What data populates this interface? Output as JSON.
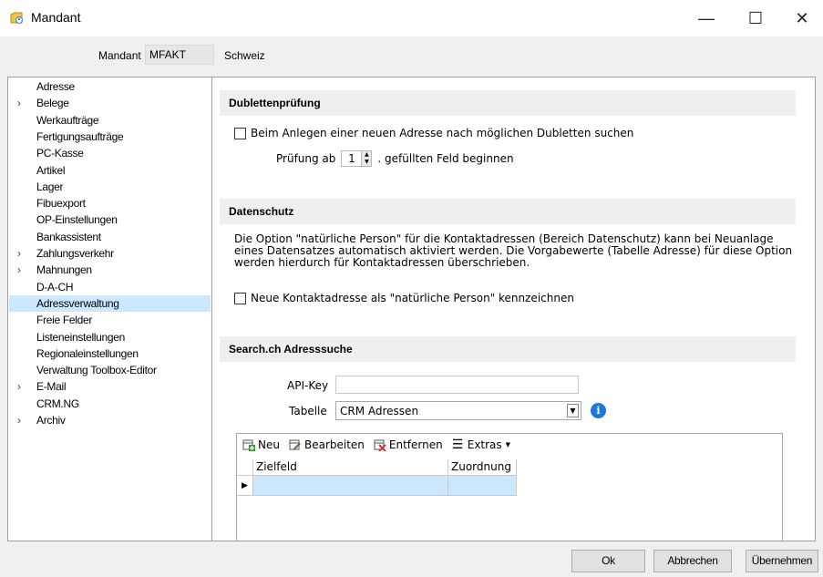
{
  "window": {
    "title": "Mandant",
    "minimize": "—",
    "maximize": "☐",
    "close": "✕"
  },
  "header": {
    "mandant_label": "Mandant",
    "mandant_code": "MFAKT",
    "mandant_name": "Schweiz"
  },
  "sidebar": {
    "items": [
      {
        "label": "Adresse",
        "expandable": false
      },
      {
        "label": "Belege",
        "expandable": true
      },
      {
        "label": "Werkaufträge",
        "expandable": false
      },
      {
        "label": "Fertigungsaufträge",
        "expandable": false
      },
      {
        "label": "PC-Kasse",
        "expandable": false
      },
      {
        "label": "Artikel",
        "expandable": false
      },
      {
        "label": "Lager",
        "expandable": false
      },
      {
        "label": "Fibuexport",
        "expandable": false
      },
      {
        "label": "OP-Einstellungen",
        "expandable": false
      },
      {
        "label": "Bankassistent",
        "expandable": false
      },
      {
        "label": "Zahlungsverkehr",
        "expandable": true
      },
      {
        "label": "Mahnungen",
        "expandable": true
      },
      {
        "label": "D-A-CH",
        "expandable": false
      },
      {
        "label": "Adressverwaltung",
        "expandable": false,
        "selected": true
      },
      {
        "label": "Freie Felder",
        "expandable": false
      },
      {
        "label": "Listeneinstellungen",
        "expandable": false
      },
      {
        "label": "Regionaleinstellungen",
        "expandable": false
      },
      {
        "label": "Verwaltung Toolbox-Editor",
        "expandable": false
      },
      {
        "label": "E-Mail",
        "expandable": true
      },
      {
        "label": "CRM.NG",
        "expandable": false
      },
      {
        "label": "Archiv",
        "expandable": true
      }
    ]
  },
  "dubletten": {
    "heading": "Dublettenprüfung",
    "checkbox_label": "Beim Anlegen einer neuen Adresse nach möglichen Dubletten suchen",
    "checked": false,
    "pruefung_prefix": "Prüfung ab",
    "pruefung_value": "1",
    "pruefung_suffix": ". gefüllten Feld beginnen"
  },
  "datenschutz": {
    "heading": "Datenschutz",
    "description": "Die Option \"natürliche Person\" für die Kontaktadressen (Bereich Datenschutz) kann bei Neuanlage eines Datensatzes automatisch aktiviert werden. Die Vorgabewerte (Tabelle Adresse) für diese Option werden hierdurch für Kontaktadressen überschrieben.",
    "checkbox_label": "Neue Kontaktadresse als \"natürliche Person\" kennzeichnen",
    "checked": false
  },
  "search": {
    "heading": "Search.ch Adresssuche",
    "api_key_label": "API-Key",
    "api_key_value": "",
    "tabelle_label": "Tabelle",
    "tabelle_value": "CRM Adressen"
  },
  "grid": {
    "toolbar": {
      "neu": "Neu",
      "bearbeiten": "Bearbeiten",
      "entfernen": "Entfernen",
      "extras": "Extras"
    },
    "columns": [
      "Zielfeld",
      "Zuordnung"
    ]
  },
  "buttons": {
    "ok": "Ok",
    "abbrechen": "Abbrechen",
    "uebernehmen": "Übernehmen"
  },
  "colors": {
    "selection": "#cce8ff",
    "info": "#1e78d7",
    "section_bg": "#efefef"
  }
}
